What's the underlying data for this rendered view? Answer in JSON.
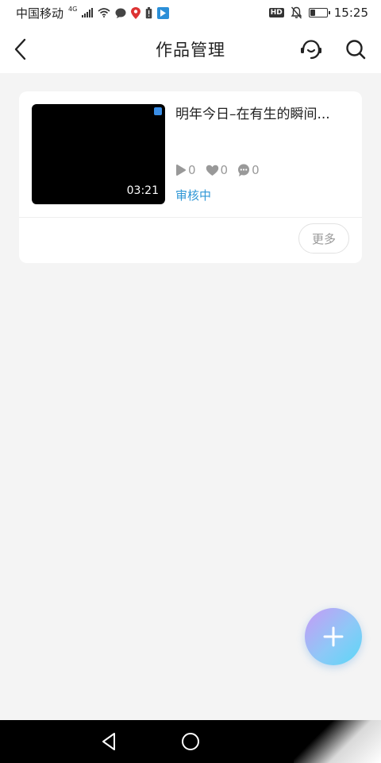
{
  "status_bar": {
    "carrier": "中国移动",
    "network_badge": "4G",
    "hd_badge": "HD",
    "time": "15:25",
    "battery_level": 0.35,
    "icons": [
      "signal-icon",
      "wifi-icon",
      "message-icon",
      "location-pin-icon",
      "battery-alert-icon",
      "app-icon",
      "mute-bell-icon",
      "battery-icon"
    ]
  },
  "header": {
    "title": "作品管理",
    "icons": {
      "back": "back-arrow-icon",
      "service": "customer-service-icon",
      "search": "search-icon"
    }
  },
  "works": [
    {
      "title": "明年今日–在有生的瞬间...",
      "duration": "03:21",
      "plays": "0",
      "likes": "0",
      "comments": "0",
      "status": "审核中",
      "status_color": "#2f97d6",
      "more_label": "更多"
    }
  ],
  "fab": {
    "icon": "plus-icon"
  },
  "nav_bar": {
    "icons": [
      "nav-back-icon",
      "nav-home-icon"
    ]
  }
}
